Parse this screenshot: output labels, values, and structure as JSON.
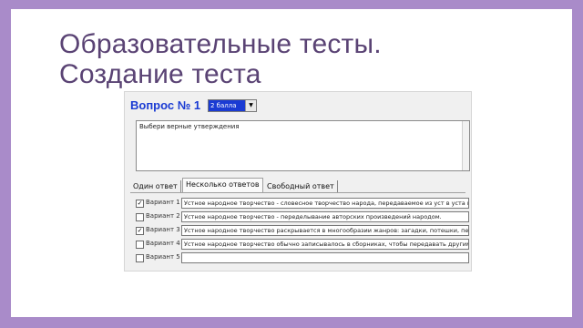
{
  "slide": {
    "title_line1": "Образовательные тесты.",
    "title_line2": "Создание теста"
  },
  "editor": {
    "question_label": "Вопрос № 1",
    "points_select": "2 балла",
    "question_text": "Выбери верные утверждения",
    "tabs": [
      {
        "label": "Один ответ",
        "active": false
      },
      {
        "label": "Несколько ответов",
        "active": true
      },
      {
        "label": "Свободный ответ",
        "active": false
      }
    ],
    "variants": [
      {
        "label": "Вариант 1",
        "checked": true,
        "text": "Устное народное творчество - словесное творчество народа, передаваемое из уст в уста и"
      },
      {
        "label": "Вариант 2",
        "checked": false,
        "text": "Устное народное творчество - переделывание авторских произведений народом."
      },
      {
        "label": "Вариант 3",
        "checked": true,
        "text": "Устное народное творчество раскрывается в многообразии жанров: загадки, потешки, пес"
      },
      {
        "label": "Вариант 4",
        "checked": false,
        "text": "Устное народное творчество обычно записывалось в сборниках, чтобы передавать другим."
      },
      {
        "label": "Вариант 5",
        "checked": false,
        "text": ""
      }
    ]
  },
  "colors": {
    "frame": "#a98bc9",
    "title": "#5a4374",
    "question_label": "#1a3bd3",
    "selection": "#1a3bd3"
  }
}
